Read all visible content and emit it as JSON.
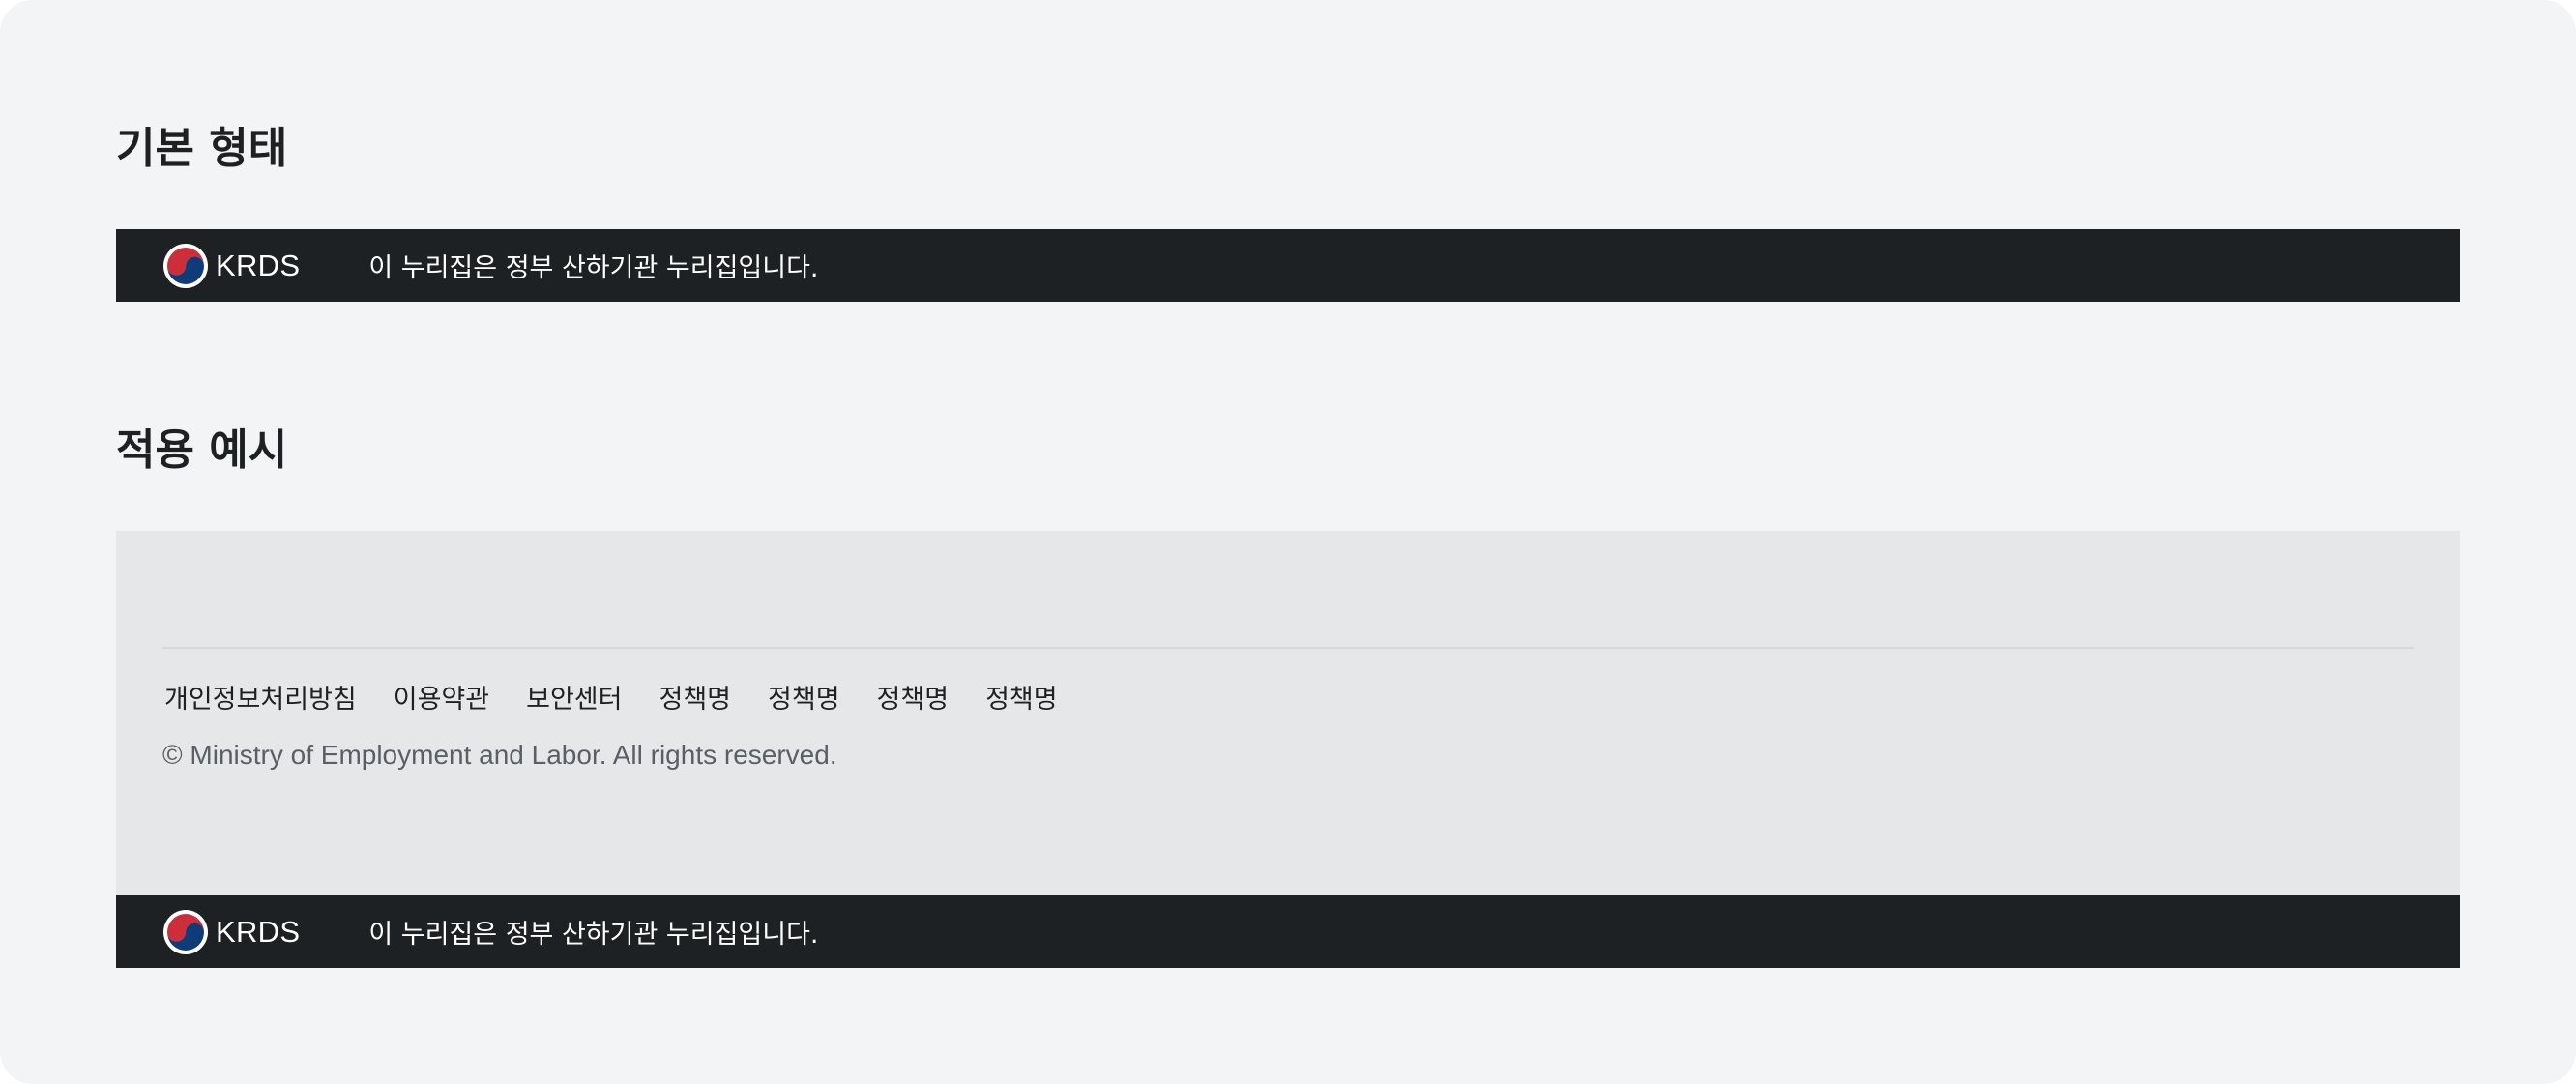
{
  "sections": {
    "basic_title": "기본 형태",
    "example_title": "적용 예시"
  },
  "identifier": {
    "brand": "KRDS",
    "notice": "이 누리집은 정부 산하기관 누리집입니다.",
    "emblem_icon": "taegeuk-emblem-icon"
  },
  "footer": {
    "links": [
      "개인정보처리방침",
      "이용약관",
      "보안센터",
      "정책명",
      "정책명",
      "정책명",
      "정책명"
    ],
    "copyright": "© Ministry of Employment and Labor. All rights reserved."
  },
  "colors": {
    "page_background": "#f3f4f6",
    "identifier_background": "#1e2124",
    "footer_background": "#e6e7e9",
    "emblem_red": "#cd2e3a",
    "emblem_blue": "#0f3b79"
  }
}
